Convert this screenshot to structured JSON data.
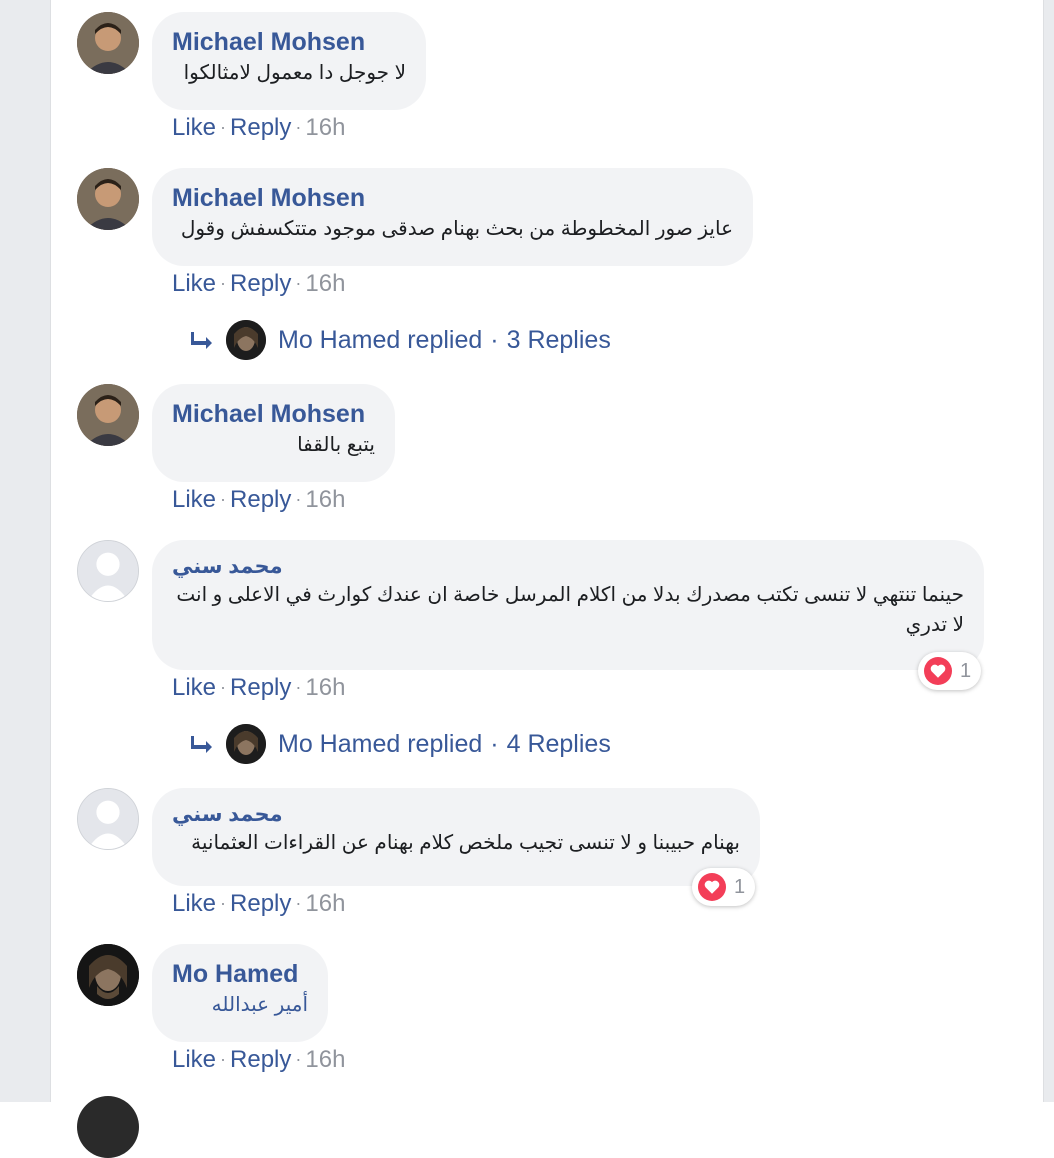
{
  "labels": {
    "like": "Like",
    "reply": "Reply",
    "dot": "·"
  },
  "colors": {
    "link": "#385898",
    "bubble": "#f2f3f5",
    "meta": "#90949c",
    "love": "#f33e58"
  },
  "comments": [
    {
      "author": "Michael Mohsen",
      "text": "لا جوجل دا معمول لامثالكوا",
      "time": "16h"
    },
    {
      "author": "Michael Mohsen",
      "text": "عايز صور المخطوطة من بحث بهنام صدقى موجود متتكسفش وقول",
      "time": "16h"
    },
    {
      "author": "Michael Mohsen",
      "text": "يتبع بالقفا",
      "time": "16h"
    },
    {
      "author": "محمد سني",
      "text": "حينما تنتهي لا تنسى تكتب مصدرك بدلا من اكلام المرسل خاصة ان عندك كوارث في الاعلى و انت لا تدري",
      "time": "16h",
      "reactions": "1"
    },
    {
      "author": "محمد سني",
      "text": "بهنام حبيبنا و لا تنسى تجيب ملخص كلام بهنام عن القراءات العثمانية",
      "time": "16h",
      "reactions": "1"
    },
    {
      "author": "Mo Hamed",
      "text": "أمير عبدالله",
      "time": "16h"
    }
  ],
  "reply_threads": [
    {
      "name": "Mo Hamed replied",
      "count": "3 Replies"
    },
    {
      "name": "Mo Hamed replied",
      "count": "4 Replies"
    }
  ]
}
